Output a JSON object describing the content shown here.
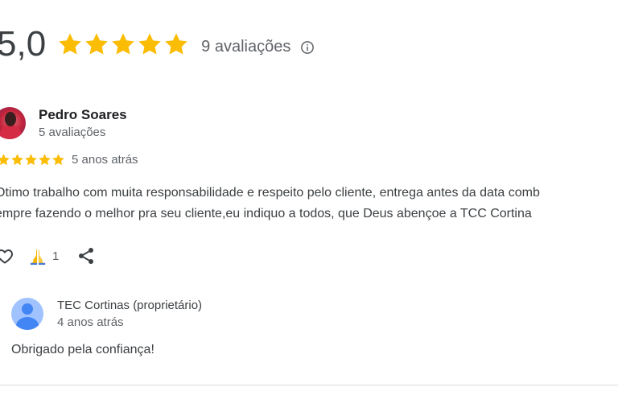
{
  "summary": {
    "score": "5,0",
    "stars": 5,
    "review_count_label": "9 avaliações",
    "star_color": "#fbbc04"
  },
  "review": {
    "reviewer_name": "Pedro Soares",
    "reviewer_review_count": "5 avaliações",
    "stars": 5,
    "date": "5 anos atrás",
    "text_line_1": "Otimo trabalho com muita responsabilidade e respeito pelo cliente, entrega antes da data comb",
    "text_line_2": "empre fazendo o melhor pra seu cliente,eu indiquo a todos, que Deus abençoe a TCC Cortina",
    "reactions": {
      "like_icon": "heart-icon",
      "pray_icon": "praying-hands-icon",
      "pray_count": "1",
      "share_icon": "share-icon"
    }
  },
  "owner_reply": {
    "name": "TEC Cortinas (proprietário)",
    "date": "4 anos atrás",
    "text": "Obrigado pela confiança!",
    "avatar_color": "#4285f4"
  }
}
